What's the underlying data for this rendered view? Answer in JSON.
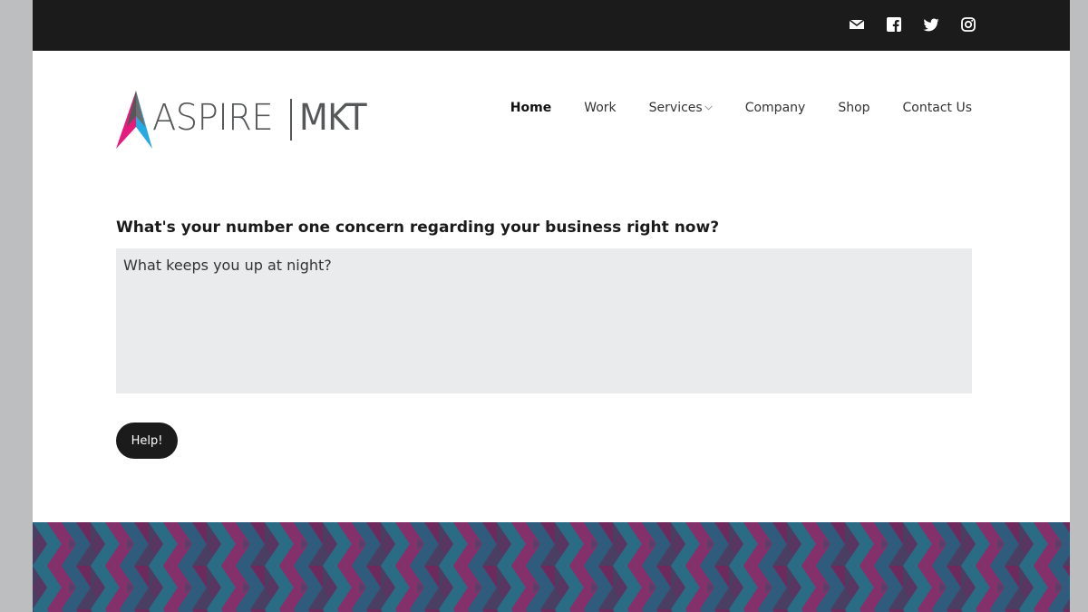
{
  "topbar": {
    "social_icons": [
      {
        "name": "envelope-icon",
        "label": "Email"
      },
      {
        "name": "facebook-icon",
        "label": "Facebook"
      },
      {
        "name": "twitter-icon",
        "label": "Twitter"
      },
      {
        "name": "instagram-icon",
        "label": "Instagram"
      }
    ]
  },
  "logo": {
    "word_left": "ASPIRE",
    "word_right": "MKT",
    "colors": {
      "magenta": "#e6197d",
      "cyan": "#27a9e1",
      "dark": "#555759"
    }
  },
  "nav": {
    "items": [
      {
        "label": "Home",
        "active": true
      },
      {
        "label": "Work"
      },
      {
        "label": "Services",
        "has_dropdown": true
      },
      {
        "label": "Company"
      },
      {
        "label": "Shop"
      },
      {
        "label": "Contact Us"
      }
    ]
  },
  "form": {
    "question": "What's your number one concern regarding your business right now?",
    "placeholder": "What keeps you up at night?",
    "value": "",
    "submit_label": "Help!"
  },
  "footer": {
    "pattern_colors": [
      "#2a6c83",
      "#6e2a5c",
      "#4a3e63",
      "#85306a",
      "#2f5c7d"
    ]
  }
}
